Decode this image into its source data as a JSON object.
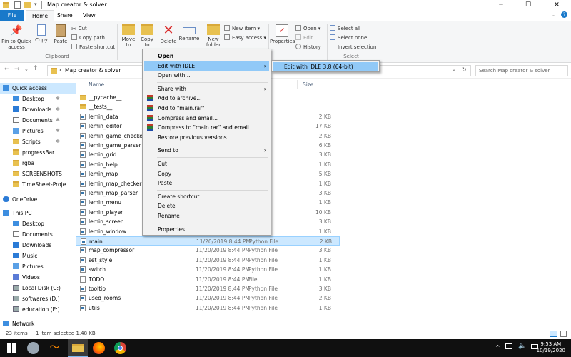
{
  "window": {
    "title": "Map creator  & solver",
    "controls": [
      "─",
      "☐",
      "✕"
    ]
  },
  "tabs": [
    "File",
    "Home",
    "Share",
    "View"
  ],
  "ribbon": {
    "pin_label": "Pin to Quick access",
    "copy_label": "Copy",
    "paste_label": "Paste",
    "cut_label": "Cut",
    "copy_path_label": "Copy path",
    "paste_shortcut_label": "Paste shortcut",
    "clipboard_group": "Clipboard",
    "move_to_label": "Move to",
    "copy_to_label": "Copy to",
    "delete_label": "Delete",
    "rename_label": "Rename",
    "new_folder_label": "New folder",
    "new_item_label": "New item",
    "easy_access_label": "Easy access",
    "properties_label": "Properties",
    "open_label": "Open",
    "edit_label": "Edit",
    "history_label": "History",
    "select_all_label": "Select all",
    "select_none_label": "Select none",
    "invert_selection_label": "Invert selection",
    "select_group": "Select"
  },
  "address": {
    "path": "Map creator  & solver",
    "search_placeholder": "Search Map creator  & solver"
  },
  "nav": {
    "items": [
      {
        "label": "Quick access",
        "kind": "quick",
        "selected": true
      },
      {
        "label": "Desktop",
        "kind": "desktop",
        "pinned": true
      },
      {
        "label": "Downloads",
        "kind": "downloads",
        "pinned": true
      },
      {
        "label": "Documents",
        "kind": "documents",
        "pinned": true
      },
      {
        "label": "Pictures",
        "kind": "pictures",
        "pinned": true
      },
      {
        "label": "Scripts",
        "kind": "folder",
        "pinned": true
      },
      {
        "label": "progressBar",
        "kind": "folder",
        "pinned": false
      },
      {
        "label": "rgba",
        "kind": "folder",
        "pinned": false
      },
      {
        "label": "SCREENSHOTS",
        "kind": "folder",
        "pinned": false
      },
      {
        "label": "TimeSheet-Proje",
        "kind": "folder",
        "pinned": false
      },
      {
        "label": "OneDrive",
        "kind": "onedrive",
        "pinned": false
      },
      {
        "label": "This PC",
        "kind": "pc",
        "pinned": false
      },
      {
        "label": "Desktop",
        "kind": "desktop",
        "pinned": false
      },
      {
        "label": "Documents",
        "kind": "documents",
        "pinned": false
      },
      {
        "label": "Downloads",
        "kind": "downloads",
        "pinned": false
      },
      {
        "label": "Music",
        "kind": "music",
        "pinned": false
      },
      {
        "label": "Pictures",
        "kind": "pictures",
        "pinned": false
      },
      {
        "label": "Videos",
        "kind": "videos",
        "pinned": false
      },
      {
        "label": "Local Disk (C:)",
        "kind": "disk",
        "pinned": false
      },
      {
        "label": "softwares (D:)",
        "kind": "disk",
        "pinned": false
      },
      {
        "label": "education (E:)",
        "kind": "disk",
        "pinned": false
      },
      {
        "label": "Network",
        "kind": "network",
        "pinned": false
      }
    ]
  },
  "columns": {
    "name": "Name",
    "size": "Size"
  },
  "files": [
    {
      "name": "__pycache__",
      "date": "",
      "type": "",
      "size": "",
      "icon": "folder"
    },
    {
      "name": "__tests__",
      "date": "",
      "type": "",
      "size": "",
      "icon": "folder"
    },
    {
      "name": "lemin_data",
      "date": "",
      "type": "le",
      "size": "2 KB",
      "icon": "py"
    },
    {
      "name": "lemin_editor",
      "date": "",
      "type": "le",
      "size": "17 KB",
      "icon": "py"
    },
    {
      "name": "lemin_game_checker",
      "date": "",
      "type": "le",
      "size": "2 KB",
      "icon": "py"
    },
    {
      "name": "lemin_game_parser",
      "date": "",
      "type": "le",
      "size": "6 KB",
      "icon": "py"
    },
    {
      "name": "lemin_grid",
      "date": "",
      "type": "le",
      "size": "3 KB",
      "icon": "py"
    },
    {
      "name": "lemin_help",
      "date": "",
      "type": "le",
      "size": "1 KB",
      "icon": "py"
    },
    {
      "name": "lemin_map",
      "date": "",
      "type": "le",
      "size": "5 KB",
      "icon": "py"
    },
    {
      "name": "lemin_map_checker",
      "date": "",
      "type": "le",
      "size": "1 KB",
      "icon": "py"
    },
    {
      "name": "lemin_map_parser",
      "date": "",
      "type": "le",
      "size": "3 KB",
      "icon": "py"
    },
    {
      "name": "lemin_menu",
      "date": "",
      "type": "le",
      "size": "1 KB",
      "icon": "py"
    },
    {
      "name": "lemin_player",
      "date": "",
      "type": "le",
      "size": "10 KB",
      "icon": "py"
    },
    {
      "name": "lemin_screen",
      "date": "",
      "type": "le",
      "size": "3 KB",
      "icon": "py"
    },
    {
      "name": "lemin_window",
      "date": "",
      "type": "le",
      "size": "1 KB",
      "icon": "py"
    },
    {
      "name": "main",
      "date": "11/20/2019 8:44 PM",
      "type": "Python File",
      "size": "2 KB",
      "icon": "py",
      "selected": true
    },
    {
      "name": "map_compressor",
      "date": "11/20/2019 8:44 PM",
      "type": "Python File",
      "size": "3 KB",
      "icon": "py"
    },
    {
      "name": "set_style",
      "date": "11/20/2019 8:44 PM",
      "type": "Python File",
      "size": "1 KB",
      "icon": "py"
    },
    {
      "name": "switch",
      "date": "11/20/2019 8:44 PM",
      "type": "Python File",
      "size": "1 KB",
      "icon": "py"
    },
    {
      "name": "TODO",
      "date": "11/20/2019 8:44 PM",
      "type": "File",
      "size": "1 KB",
      "icon": "txt"
    },
    {
      "name": "tooltip",
      "date": "11/20/2019 8:44 PM",
      "type": "Python File",
      "size": "3 KB",
      "icon": "py"
    },
    {
      "name": "used_rooms",
      "date": "11/20/2019 8:44 PM",
      "type": "Python File",
      "size": "2 KB",
      "icon": "py"
    },
    {
      "name": "utils",
      "date": "11/20/2019 8:44 PM",
      "type": "Python File",
      "size": "1 KB",
      "icon": "py"
    }
  ],
  "context_menu": [
    {
      "label": "Open",
      "bold": true
    },
    {
      "label": "Edit with IDLE",
      "submenu": true,
      "highlighted": true
    },
    {
      "label": "Open with..."
    },
    {
      "sep": true
    },
    {
      "label": "Share with",
      "submenu": true
    },
    {
      "label": "Add to archive...",
      "icon": "rar"
    },
    {
      "label": "Add to \"main.rar\"",
      "icon": "rar"
    },
    {
      "label": "Compress and email...",
      "icon": "rar"
    },
    {
      "label": "Compress to \"main.rar\" and email",
      "icon": "rar"
    },
    {
      "label": "Restore previous versions"
    },
    {
      "sep": true
    },
    {
      "label": "Send to",
      "submenu": true
    },
    {
      "sep": true
    },
    {
      "label": "Cut"
    },
    {
      "label": "Copy"
    },
    {
      "label": "Paste"
    },
    {
      "sep": true
    },
    {
      "label": "Create shortcut"
    },
    {
      "label": "Delete"
    },
    {
      "label": "Rename"
    },
    {
      "sep": true
    },
    {
      "label": "Properties"
    }
  ],
  "submenu": {
    "label": "Edit with IDLE 3.8 (64-bit)"
  },
  "status": {
    "items": "23 items",
    "selected": "1 item selected  1.48 KB"
  },
  "clock": {
    "time": "9:53 AM",
    "date": "10/19/2020"
  },
  "colors": {
    "accent": "#1979ca",
    "selection": "#cce8ff",
    "menu_highlight": "#91c9f7"
  }
}
